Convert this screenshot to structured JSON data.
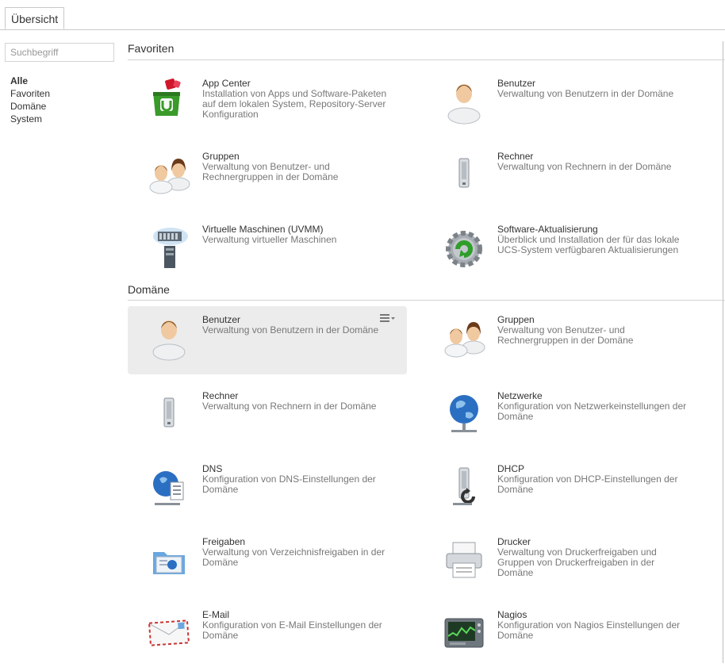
{
  "tabs": [
    {
      "label": "Übersicht"
    }
  ],
  "search": {
    "placeholder": "Suchbegriff"
  },
  "categories": [
    "Alle",
    "Favoriten",
    "Domäne",
    "System"
  ],
  "sections": {
    "favorites": {
      "title": "Favoriten",
      "tiles": [
        {
          "name": "App Center",
          "desc": "Installation von Apps und Software-Paketen auf dem lokalen System, Repository-Server Konfiguration",
          "icon": "app-center-icon"
        },
        {
          "name": "Benutzer",
          "desc": "Verwaltung von Benutzern in der Domäne",
          "icon": "user-icon"
        },
        {
          "name": "Gruppen",
          "desc": "Verwaltung von Benutzer- und Rechnergruppen in der Domäne",
          "icon": "groups-icon"
        },
        {
          "name": "Rechner",
          "desc": "Verwaltung von Rechnern in der Domäne",
          "icon": "computer-icon"
        },
        {
          "name": "Virtuelle Maschinen (UVMM)",
          "desc": "Verwaltung virtueller Maschinen",
          "icon": "uvmm-icon"
        },
        {
          "name": "Software-Aktualisierung",
          "desc": "Überblick und Installation der für das lokale UCS-System verfügbaren Aktualisierungen",
          "icon": "software-update-icon"
        }
      ]
    },
    "domain": {
      "title": "Domäne",
      "tiles": [
        {
          "name": "Benutzer",
          "desc": "Verwaltung von Benutzern in der Domäne",
          "icon": "user-icon"
        },
        {
          "name": "Gruppen",
          "desc": "Verwaltung von Benutzer- und Rechnergruppen in der Domäne",
          "icon": "groups-icon"
        },
        {
          "name": "Rechner",
          "desc": "Verwaltung von Rechnern in der Domäne",
          "icon": "computer-icon"
        },
        {
          "name": "Netzwerke",
          "desc": "Konfiguration von Netzwerkeinstellungen der Domäne",
          "icon": "network-icon"
        },
        {
          "name": "DNS",
          "desc": "Konfiguration von DNS-Einstellungen der Domäne",
          "icon": "dns-icon"
        },
        {
          "name": "DHCP",
          "desc": "Konfiguration von DHCP-Einstellungen der Domäne",
          "icon": "dhcp-icon"
        },
        {
          "name": "Freigaben",
          "desc": "Verwaltung von Verzeichnisfreigaben in der Domäne",
          "icon": "shares-icon"
        },
        {
          "name": "Drucker",
          "desc": "Verwaltung von Druckerfreigaben und Gruppen von Druckerfreigaben in der Domäne",
          "icon": "printer-icon"
        },
        {
          "name": "E-Mail",
          "desc": "Konfiguration von E-Mail Einstellungen der Domäne",
          "icon": "mail-icon"
        },
        {
          "name": "Nagios",
          "desc": "Konfiguration von Nagios Einstellungen der Domäne",
          "icon": "nagios-icon"
        }
      ]
    }
  }
}
